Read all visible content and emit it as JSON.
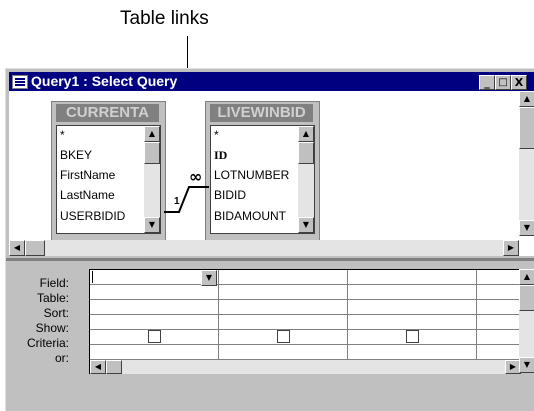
{
  "callout": {
    "text": "Table links"
  },
  "window": {
    "title": "Query1 : Select Query",
    "controls": {
      "minimize": "_",
      "maximize": "□",
      "close": "X"
    }
  },
  "tables": [
    {
      "name": "CURRENTA",
      "fields": [
        "*",
        "BKEY",
        "FirstName",
        "LastName",
        "USERBIDID"
      ]
    },
    {
      "name": "LIVEWINBID",
      "fields": [
        "*",
        "ID",
        "LOTNUMBER",
        "BIDID",
        "BIDAMOUNT"
      ]
    }
  ],
  "join": {
    "one_label": "1",
    "many_label": "∞"
  },
  "grid": {
    "row_labels": [
      "Field:",
      "Table:",
      "Sort:",
      "Show:",
      "Criteria:",
      "or:"
    ],
    "columns": 4,
    "show_checked": [
      false,
      false,
      false
    ]
  },
  "icons": [
    "window-icon",
    "minimize-icon",
    "maximize-icon",
    "close-icon",
    "arrow-up-icon",
    "arrow-down-icon",
    "arrow-left-icon",
    "arrow-right-icon"
  ]
}
